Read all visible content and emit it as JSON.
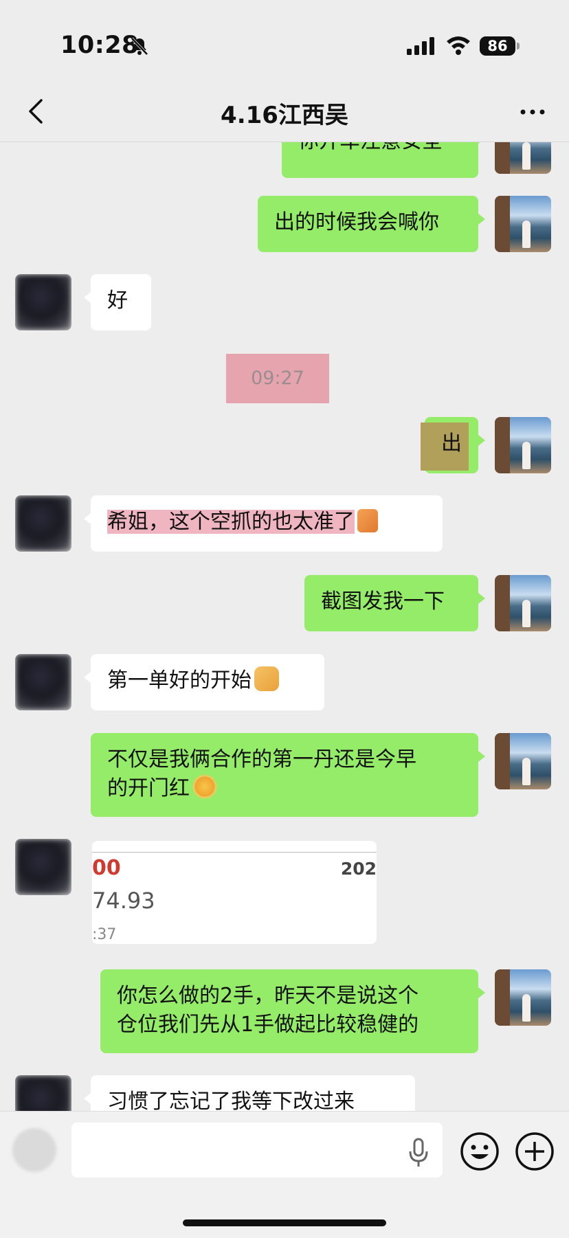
{
  "status_bar": {
    "time": "10:28",
    "battery": "86"
  },
  "header": {
    "title": "4.16江西吴"
  },
  "messages": [
    {
      "side": "me",
      "text": "你开车注意安全"
    },
    {
      "side": "me",
      "text": "出的时候我会喊你"
    },
    {
      "side": "them",
      "text": "好"
    },
    {
      "type": "time",
      "text": "09:27"
    },
    {
      "side": "me",
      "text": "出"
    },
    {
      "side": "them",
      "text": "希姐，这个空抓的也太准了",
      "emoji": "thumbs-up"
    },
    {
      "side": "me",
      "text": "截图发我一下"
    },
    {
      "side": "them",
      "text": "第一单好的开始",
      "emoji": "handshake"
    },
    {
      "side": "me",
      "lines": [
        "不仅是我俩合作的第一丹还是今早",
        "的开门红"
      ],
      "emoji": "sun-face"
    },
    {
      "side": "them",
      "type": "image",
      "card": {
        "red_text": "00",
        "year_text": "202",
        "price": "74.93",
        "time": ":37"
      }
    },
    {
      "side": "me",
      "lines": [
        "你怎么做的2手，昨天不是说这个",
        "仓位我们先从1手做起比较稳健的"
      ]
    },
    {
      "side": "them",
      "text": "习惯了忘记了我等下改过来"
    }
  ],
  "input": {
    "placeholder": ""
  },
  "colors": {
    "my_bubble": "#95ec69",
    "their_bubble": "#ffffff",
    "background": "#ededed"
  }
}
